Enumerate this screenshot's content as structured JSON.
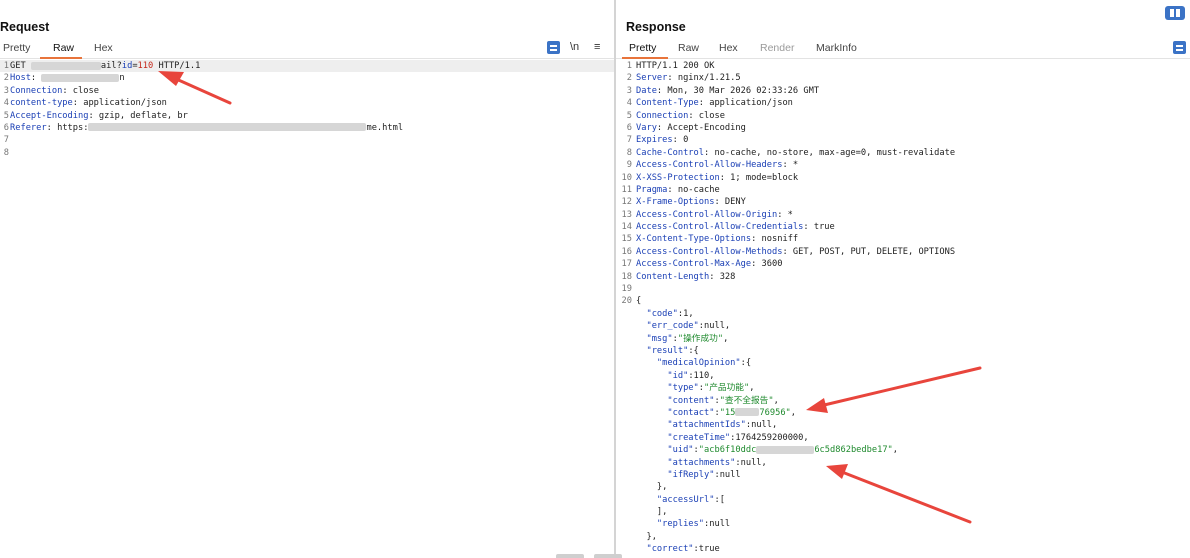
{
  "request": {
    "title": "Request",
    "tabs": [
      "Pretty",
      "Raw",
      "Hex"
    ],
    "selected_tab": "Raw",
    "newline_toggle": "\\n",
    "lines": [
      {
        "n": "1",
        "parts": [
          {
            "t": "GET ",
            "c": "pv"
          },
          {
            "blur": 70
          },
          {
            "t": "ail?",
            "c": "pv"
          },
          {
            "t": "id",
            "c": "hk"
          },
          {
            "t": "=",
            "c": "pv"
          },
          {
            "t": "110",
            "c": "num"
          },
          {
            "t": " HTTP/1.1",
            "c": "pv"
          }
        ]
      },
      {
        "n": "2",
        "parts": [
          {
            "t": "Host",
            "c": "hk"
          },
          {
            "t": ": ",
            "c": "pv"
          },
          {
            "blur": 78
          },
          {
            "t": "n",
            "c": "pv"
          }
        ]
      },
      {
        "n": "3",
        "parts": [
          {
            "t": "Connection",
            "c": "hk"
          },
          {
            "t": ": close",
            "c": "pv"
          }
        ]
      },
      {
        "n": "4",
        "parts": [
          {
            "t": "content-type",
            "c": "hk"
          },
          {
            "t": ": application/json",
            "c": "pv"
          }
        ]
      },
      {
        "n": "5",
        "parts": [
          {
            "t": "Accept-Encoding",
            "c": "hk"
          },
          {
            "t": ": gzip, deflate, br",
            "c": "pv"
          }
        ]
      },
      {
        "n": "6",
        "parts": [
          {
            "t": "Referer",
            "c": "hk"
          },
          {
            "t": ": https:",
            "c": "pv"
          },
          {
            "blur": 278
          },
          {
            "t": "me.html",
            "c": "pv"
          }
        ]
      },
      {
        "n": "7",
        "parts": []
      },
      {
        "n": "8",
        "parts": []
      }
    ]
  },
  "response": {
    "title": "Response",
    "tabs": [
      "Pretty",
      "Raw",
      "Hex",
      "Render",
      "MarkInfo"
    ],
    "selected_tab": "Pretty",
    "disabled_tab": "Render",
    "lines": [
      {
        "n": "1",
        "parts": [
          {
            "t": "HTTP/1.1 200 OK",
            "c": "pv"
          }
        ]
      },
      {
        "n": "2",
        "parts": [
          {
            "t": "Server",
            "c": "hk"
          },
          {
            "t": ": nginx/1.21.5",
            "c": "pv"
          }
        ]
      },
      {
        "n": "3",
        "parts": [
          {
            "t": "Date",
            "c": "hk"
          },
          {
            "t": ": Mon, 30 Mar 2026 02:33:26 GMT",
            "c": "pv"
          }
        ]
      },
      {
        "n": "4",
        "parts": [
          {
            "t": "Content-Type",
            "c": "hk"
          },
          {
            "t": ": application/json",
            "c": "pv"
          }
        ]
      },
      {
        "n": "5",
        "parts": [
          {
            "t": "Connection",
            "c": "hk"
          },
          {
            "t": ": close",
            "c": "pv"
          }
        ]
      },
      {
        "n": "6",
        "parts": [
          {
            "t": "Vary",
            "c": "hk"
          },
          {
            "t": ": Accept-Encoding",
            "c": "pv"
          }
        ]
      },
      {
        "n": "7",
        "parts": [
          {
            "t": "Expires",
            "c": "hk"
          },
          {
            "t": ": 0",
            "c": "pv"
          }
        ]
      },
      {
        "n": "8",
        "parts": [
          {
            "t": "Cache-Control",
            "c": "hk"
          },
          {
            "t": ": no-cache, no-store, max-age=0, must-revalidate",
            "c": "pv"
          }
        ]
      },
      {
        "n": "9",
        "parts": [
          {
            "t": "Access-Control-Allow-Headers",
            "c": "hk"
          },
          {
            "t": ": *",
            "c": "pv"
          }
        ]
      },
      {
        "n": "10",
        "parts": [
          {
            "t": "X-XSS-Protection",
            "c": "hk"
          },
          {
            "t": ": 1; mode=block",
            "c": "pv"
          }
        ]
      },
      {
        "n": "11",
        "parts": [
          {
            "t": "Pragma",
            "c": "hk"
          },
          {
            "t": ": no-cache",
            "c": "pv"
          }
        ]
      },
      {
        "n": "12",
        "parts": [
          {
            "t": "X-Frame-Options",
            "c": "hk"
          },
          {
            "t": ": DENY",
            "c": "pv"
          }
        ]
      },
      {
        "n": "13",
        "parts": [
          {
            "t": "Access-Control-Allow-Origin",
            "c": "hk"
          },
          {
            "t": ": *",
            "c": "pv"
          }
        ]
      },
      {
        "n": "14",
        "parts": [
          {
            "t": "Access-Control-Allow-Credentials",
            "c": "hk"
          },
          {
            "t": ": true",
            "c": "pv"
          }
        ]
      },
      {
        "n": "15",
        "parts": [
          {
            "t": "X-Content-Type-Options",
            "c": "hk"
          },
          {
            "t": ": nosniff",
            "c": "pv"
          }
        ]
      },
      {
        "n": "16",
        "parts": [
          {
            "t": "Access-Control-Allow-Methods",
            "c": "hk"
          },
          {
            "t": ": GET, POST, PUT, DELETE, OPTIONS",
            "c": "pv"
          }
        ]
      },
      {
        "n": "17",
        "parts": [
          {
            "t": "Access-Control-Max-Age",
            "c": "hk"
          },
          {
            "t": ": 3600",
            "c": "pv"
          }
        ]
      },
      {
        "n": "18",
        "parts": [
          {
            "t": "Content-Length",
            "c": "hk"
          },
          {
            "t": ": 328",
            "c": "pv"
          }
        ]
      },
      {
        "n": "19",
        "parts": []
      },
      {
        "n": "20",
        "parts": [
          {
            "t": "{",
            "c": "pv"
          }
        ]
      },
      {
        "n": "",
        "parts": [
          {
            "t": "  ",
            "c": "pv"
          },
          {
            "t": "\"code\"",
            "c": "key"
          },
          {
            "t": ":1,",
            "c": "pv"
          }
        ]
      },
      {
        "n": "",
        "parts": [
          {
            "t": "  ",
            "c": "pv"
          },
          {
            "t": "\"err_code\"",
            "c": "key"
          },
          {
            "t": ":null,",
            "c": "pv"
          }
        ]
      },
      {
        "n": "",
        "parts": [
          {
            "t": "  ",
            "c": "pv"
          },
          {
            "t": "\"msg\"",
            "c": "key"
          },
          {
            "t": ":",
            "c": "pv"
          },
          {
            "t": "\"操作成功\"",
            "c": "str"
          },
          {
            "t": ",",
            "c": "pv"
          }
        ]
      },
      {
        "n": "",
        "parts": [
          {
            "t": "  ",
            "c": "pv"
          },
          {
            "t": "\"result\"",
            "c": "key"
          },
          {
            "t": ":{",
            "c": "pv"
          }
        ]
      },
      {
        "n": "",
        "parts": [
          {
            "t": "    ",
            "c": "pv"
          },
          {
            "t": "\"medicalOpinion\"",
            "c": "key"
          },
          {
            "t": ":{",
            "c": "pv"
          }
        ]
      },
      {
        "n": "",
        "parts": [
          {
            "t": "      ",
            "c": "pv"
          },
          {
            "t": "\"id\"",
            "c": "key"
          },
          {
            "t": ":110,",
            "c": "pv"
          }
        ]
      },
      {
        "n": "",
        "parts": [
          {
            "t": "      ",
            "c": "pv"
          },
          {
            "t": "\"type\"",
            "c": "key"
          },
          {
            "t": ":",
            "c": "pv"
          },
          {
            "t": "\"产品功能\"",
            "c": "str"
          },
          {
            "t": ",",
            "c": "pv"
          }
        ]
      },
      {
        "n": "",
        "parts": [
          {
            "t": "      ",
            "c": "pv"
          },
          {
            "t": "\"content\"",
            "c": "key"
          },
          {
            "t": ":",
            "c": "pv"
          },
          {
            "t": "\"查不全报告\"",
            "c": "str"
          },
          {
            "t": ",",
            "c": "pv"
          }
        ]
      },
      {
        "n": "",
        "parts": [
          {
            "t": "      ",
            "c": "pv"
          },
          {
            "t": "\"contact\"",
            "c": "key"
          },
          {
            "t": ":",
            "c": "pv"
          },
          {
            "t": "\"15",
            "c": "str"
          },
          {
            "blur": 24
          },
          {
            "t": "76956\"",
            "c": "str"
          },
          {
            "t": ",",
            "c": "pv"
          }
        ]
      },
      {
        "n": "",
        "parts": [
          {
            "t": "      ",
            "c": "pv"
          },
          {
            "t": "\"attachmentIds\"",
            "c": "key"
          },
          {
            "t": ":null,",
            "c": "pv"
          }
        ]
      },
      {
        "n": "",
        "parts": [
          {
            "t": "      ",
            "c": "pv"
          },
          {
            "t": "\"createTime\"",
            "c": "key"
          },
          {
            "t": ":1764259200000,",
            "c": "pv"
          }
        ]
      },
      {
        "n": "",
        "parts": [
          {
            "t": "      ",
            "c": "pv"
          },
          {
            "t": "\"uid\"",
            "c": "key"
          },
          {
            "t": ":",
            "c": "pv"
          },
          {
            "t": "\"acb6f10ddc",
            "c": "str"
          },
          {
            "blur": 58
          },
          {
            "t": "6c5d862bedbe17\"",
            "c": "str"
          },
          {
            "t": ",",
            "c": "pv"
          }
        ]
      },
      {
        "n": "",
        "parts": [
          {
            "t": "      ",
            "c": "pv"
          },
          {
            "t": "\"attachments\"",
            "c": "key"
          },
          {
            "t": ":null,",
            "c": "pv"
          }
        ]
      },
      {
        "n": "",
        "parts": [
          {
            "t": "      ",
            "c": "pv"
          },
          {
            "t": "\"ifReply\"",
            "c": "key"
          },
          {
            "t": ":null",
            "c": "pv"
          }
        ]
      },
      {
        "n": "",
        "parts": [
          {
            "t": "    },",
            "c": "pv"
          }
        ]
      },
      {
        "n": "",
        "parts": [
          {
            "t": "    ",
            "c": "pv"
          },
          {
            "t": "\"accessUrl\"",
            "c": "key"
          },
          {
            "t": ":[",
            "c": "pv"
          }
        ]
      },
      {
        "n": "",
        "parts": [
          {
            "t": "    ],",
            "c": "pv"
          }
        ]
      },
      {
        "n": "",
        "parts": [
          {
            "t": "    ",
            "c": "pv"
          },
          {
            "t": "\"replies\"",
            "c": "key"
          },
          {
            "t": ":null",
            "c": "pv"
          }
        ]
      },
      {
        "n": "",
        "parts": [
          {
            "t": "  },",
            "c": "pv"
          }
        ]
      },
      {
        "n": "",
        "parts": [
          {
            "t": "  ",
            "c": "pv"
          },
          {
            "t": "\"correct\"",
            "c": "key"
          },
          {
            "t": ":true",
            "c": "pv"
          }
        ]
      }
    ]
  },
  "annotation_color": "#e8453c",
  "accent_color": "#e8743b",
  "icon_color": "#3b73c6"
}
